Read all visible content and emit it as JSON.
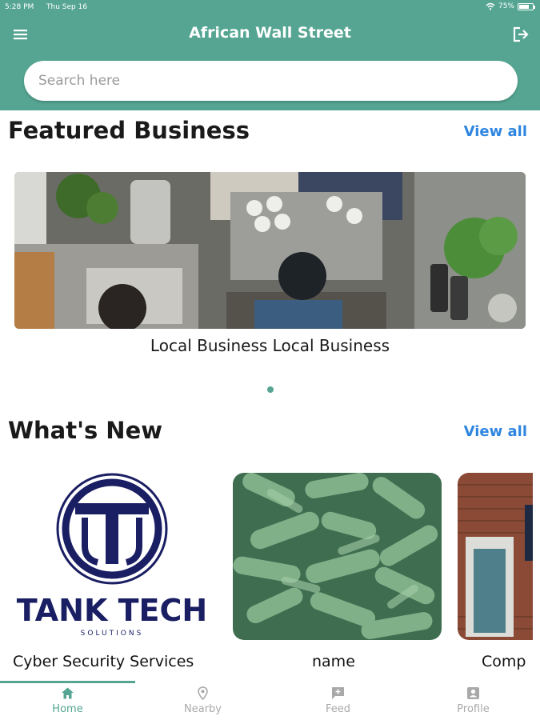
{
  "status_bar": {
    "time": "5:28 PM",
    "date": "Thu Sep 16",
    "battery": "75%",
    "battery_level": 0.75
  },
  "app_bar": {
    "title": "African Wall Street",
    "menu_icon": "menu-icon",
    "logout_icon": "logout-icon"
  },
  "search": {
    "placeholder": "Search here",
    "value": ""
  },
  "featured": {
    "title": "Featured Business",
    "view_all": "View all",
    "items": [
      {
        "name": "Local Business Local Business",
        "image": "coffee-shop-photo"
      }
    ],
    "active_index": 0
  },
  "whats_new": {
    "title": "What's New",
    "view_all": "View all",
    "items": [
      {
        "name": "Cyber Security Services",
        "image": "tank-tech-logo",
        "logo_text": "TANK TECH",
        "logo_subtext": "SOLUTIONS"
      },
      {
        "name": "name",
        "image": "green-texture-photo"
      },
      {
        "name": "Comp",
        "image": "brick-building-photo"
      }
    ]
  },
  "bottom_nav": {
    "active": "Home",
    "items": [
      {
        "label": "Home",
        "icon": "home-icon"
      },
      {
        "label": "Nearby",
        "icon": "location-pin-icon"
      },
      {
        "label": "Feed",
        "icon": "feed-icon"
      },
      {
        "label": "Profile",
        "icon": "profile-icon"
      }
    ]
  },
  "colors": {
    "primary": "#55a592",
    "link": "#2f86e0",
    "inactive": "#a9a9a9"
  }
}
